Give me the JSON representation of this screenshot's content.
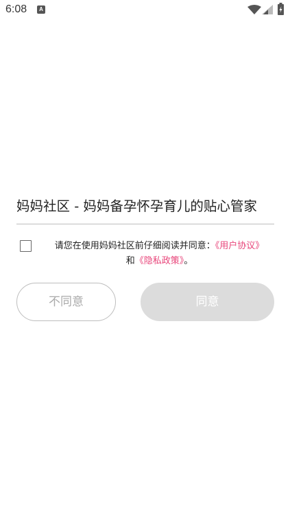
{
  "status_bar": {
    "time": "6:08",
    "notification_badge": "A",
    "icons": [
      "wifi-icon",
      "signal-icon",
      "battery-charging-icon"
    ]
  },
  "dialog": {
    "title": "妈妈社区 - 妈妈备孕怀孕育儿的贴心管家",
    "consent": {
      "prefix": "请您在使用妈妈社区前仔细阅读并同意：",
      "user_agreement": "《用户协议》",
      "connector": "和",
      "privacy_policy": "《隐私政策》",
      "suffix": "。"
    },
    "checkbox_checked": false,
    "disagree_label": "不同意",
    "agree_label": "同意"
  },
  "colors": {
    "link": "#e8457a",
    "disabled_button": "#dcdcdc",
    "divider": "#bdbdbd"
  }
}
